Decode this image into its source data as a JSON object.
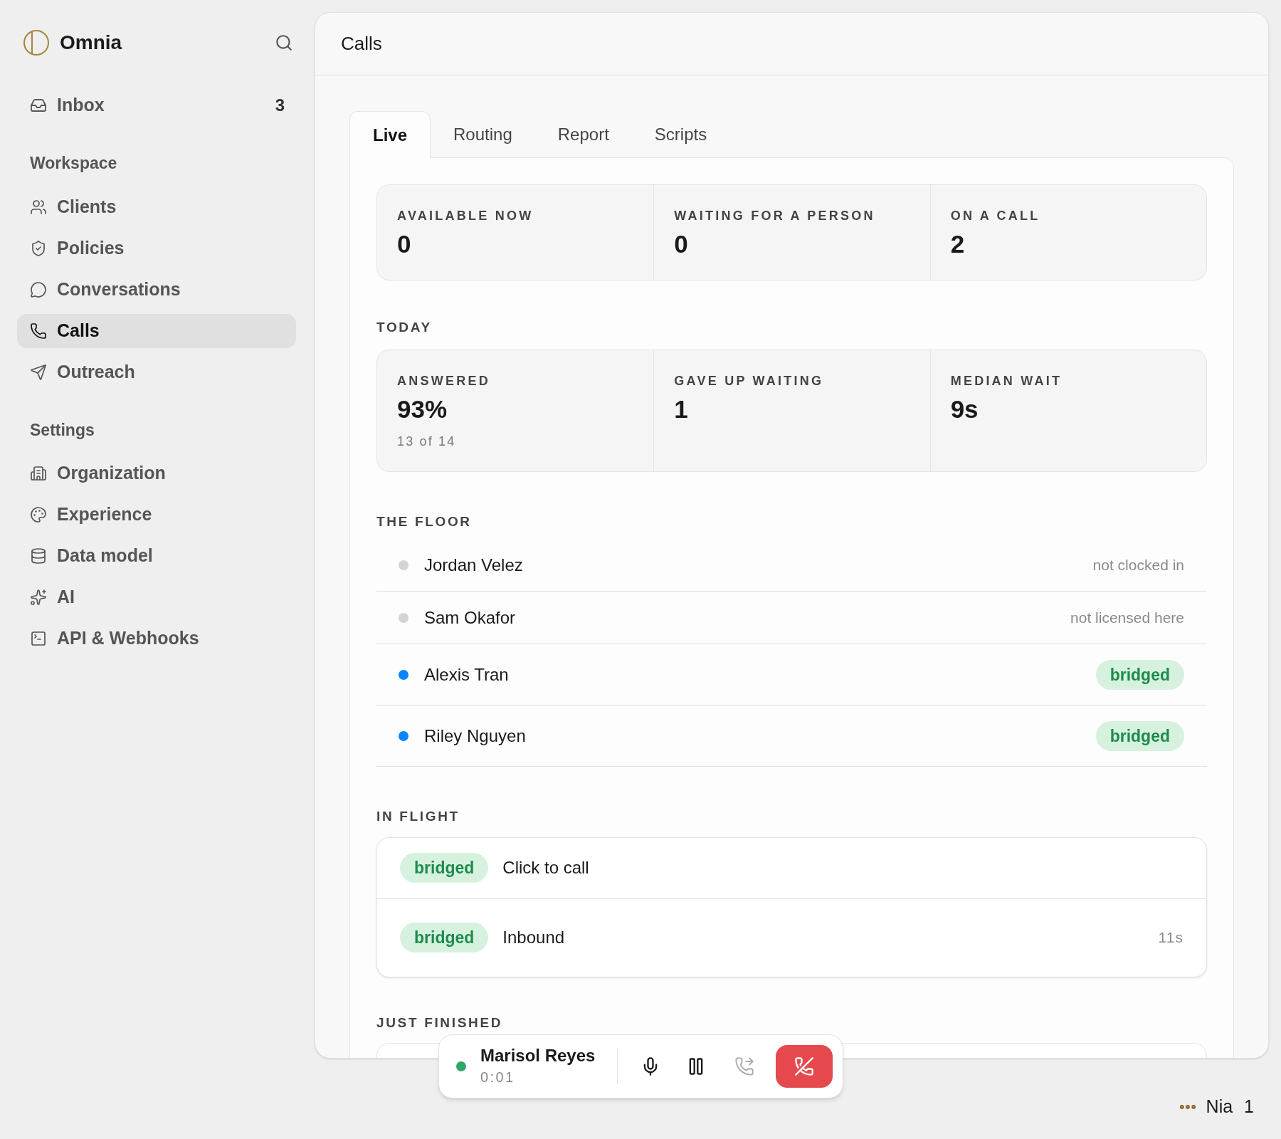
{
  "app": {
    "name": "Omnia"
  },
  "sidebar": {
    "inbox": {
      "label": "Inbox",
      "count": "3"
    },
    "sections": [
      {
        "title": "Workspace",
        "items": [
          {
            "label": "Clients",
            "selected": false
          },
          {
            "label": "Policies",
            "selected": false
          },
          {
            "label": "Conversations",
            "selected": false
          },
          {
            "label": "Calls",
            "selected": true
          },
          {
            "label": "Outreach",
            "selected": false
          }
        ]
      },
      {
        "title": "Settings",
        "items": [
          {
            "label": "Organization",
            "selected": false
          },
          {
            "label": "Experience",
            "selected": false
          },
          {
            "label": "Data model",
            "selected": false
          },
          {
            "label": "AI",
            "selected": false
          },
          {
            "label": "API & Webhooks",
            "selected": false
          }
        ]
      }
    ]
  },
  "page": {
    "title": "Calls"
  },
  "tabs": [
    {
      "label": "Live",
      "selected": true
    },
    {
      "label": "Routing",
      "selected": false
    },
    {
      "label": "Report",
      "selected": false
    },
    {
      "label": "Scripts",
      "selected": false
    }
  ],
  "live_stats": [
    {
      "label": "AVAILABLE NOW",
      "value": "0"
    },
    {
      "label": "WAITING FOR A PERSON",
      "value": "0"
    },
    {
      "label": "ON A CALL",
      "value": "2"
    }
  ],
  "today": {
    "title": "TODAY",
    "stats": [
      {
        "label": "ANSWERED",
        "value": "93%",
        "sub": "13 of 14"
      },
      {
        "label": "GAVE UP WAITING",
        "value": "1"
      },
      {
        "label": "MEDIAN WAIT",
        "value": "9s"
      }
    ]
  },
  "floor": {
    "title": "THE FLOOR",
    "agents": [
      {
        "name": "Jordan Velez",
        "color": "#d4d4d4",
        "kind": "note",
        "status": "not clocked in"
      },
      {
        "name": "Sam Okafor",
        "color": "#d4d4d4",
        "kind": "note",
        "status": "not licensed here"
      },
      {
        "name": "Alexis Tran",
        "color": "#0a84ff",
        "kind": "badge",
        "status": "bridged"
      },
      {
        "name": "Riley Nguyen",
        "color": "#0a84ff",
        "kind": "badge",
        "status": "bridged"
      }
    ]
  },
  "in_flight": {
    "title": "IN FLIGHT",
    "calls": [
      {
        "status": "bridged",
        "label": "Click to call"
      },
      {
        "status": "bridged",
        "label": "Inbound",
        "duration": "11s"
      }
    ]
  },
  "just_finished": {
    "title": "JUST FINISHED"
  },
  "call_bar": {
    "name": "Marisol Reyes",
    "time": "0:01"
  },
  "user": {
    "name": "Nia",
    "count": "1"
  }
}
